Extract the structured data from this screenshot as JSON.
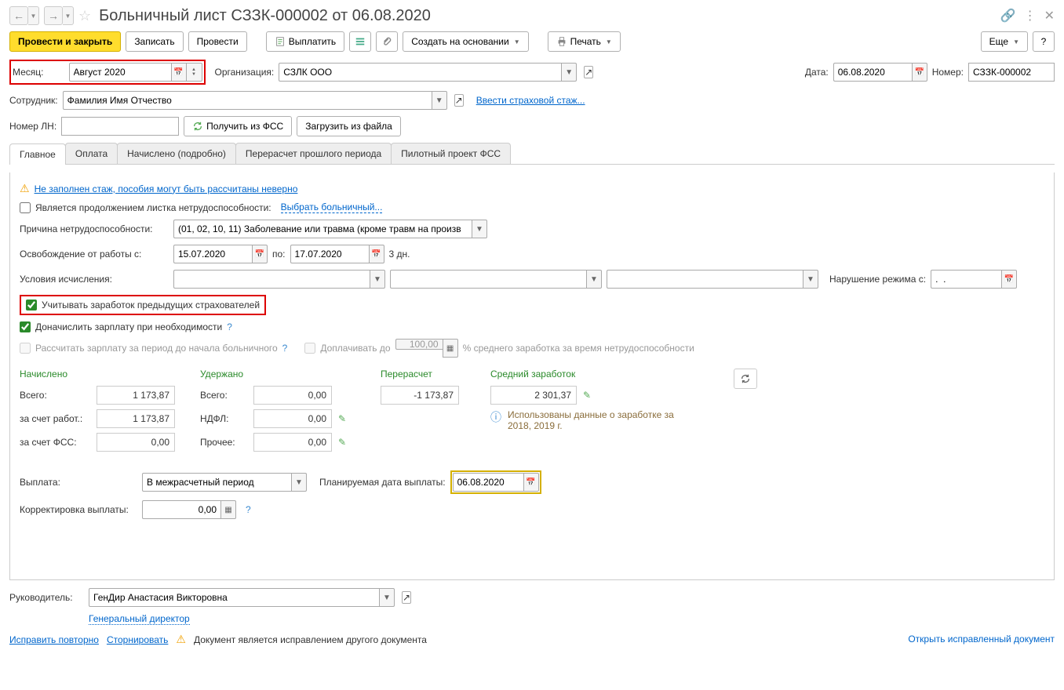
{
  "title": "Больничный лист СЗЗК-000002 от 06.08.2020",
  "toolbar": {
    "post_close": "Провести и закрыть",
    "save": "Записать",
    "post": "Провести",
    "pay": "Выплатить",
    "create_based": "Создать на основании",
    "print": "Печать",
    "more": "Еще"
  },
  "fields": {
    "month_label": "Месяц:",
    "month": "Август 2020",
    "org_label": "Организация:",
    "org": "СЗЛК ООО",
    "date_label": "Дата:",
    "date": "06.08.2020",
    "number_label": "Номер:",
    "number": "СЗЗК-000002",
    "employee_label": "Сотрудник:",
    "employee": "Фамилия Имя Отчество",
    "insurance_link": "Ввести страховой стаж...",
    "ln_label": "Номер ЛН:",
    "get_fss": "Получить из ФСС",
    "load_file": "Загрузить из файла"
  },
  "tabs": [
    "Главное",
    "Оплата",
    "Начислено (подробно)",
    "Перерасчет прошлого периода",
    "Пилотный проект ФСС"
  ],
  "main": {
    "warning": "Не заполнен стаж, пособия могут быть рассчитаны неверно",
    "is_continuation": "Является продолжением листка нетрудоспособности:",
    "select_sick": "Выбрать больничный...",
    "reason_label": "Причина нетрудоспособности:",
    "reason": "(01, 02, 10, 11) Заболевание или травма (кроме травм на произв",
    "exempt_from": "Освобождение от работы с:",
    "date_from": "15.07.2020",
    "date_to_label": "по:",
    "date_to": "17.07.2020",
    "days": "3 дн.",
    "calc_cond": "Условия исчисления:",
    "violation_label": "Нарушение режима с:",
    "violation_date": ".  .",
    "cb_prev_insurers": "Учитывать заработок предыдущих страхователей",
    "cb_add_salary": "Доначислить зарплату при необходимости",
    "cb_calc_salary": "Рассчитать зарплату за период до начала больничного",
    "cb_pay_up": "Доплачивать до",
    "pay_up_val": "100,00",
    "pay_up_suffix": "% среднего заработка за время нетрудоспособности"
  },
  "summary": {
    "accrued": "Начислено",
    "withheld": "Удержано",
    "recalc": "Перерасчет",
    "avg_earn": "Средний заработок",
    "total": "Всего:",
    "employer": "за счет работ.:",
    "fss": "за счет ФСС:",
    "ndfl": "НДФЛ:",
    "other": "Прочее:",
    "accrued_total": "1 173,87",
    "accrued_employer": "1 173,87",
    "accrued_fss": "0,00",
    "withheld_total": "0,00",
    "withheld_ndfl": "0,00",
    "withheld_other": "0,00",
    "recalc_val": "-1 173,87",
    "avg_val": "2 301,37",
    "info_text": "Использованы данные о заработке за 2018, 2019 г."
  },
  "payment": {
    "label": "Выплата:",
    "value": "В межрасчетный период",
    "planned_label": "Планируемая дата выплаты:",
    "planned_date": "06.08.2020",
    "corr_label": "Корректировка выплаты:",
    "corr_val": "0,00"
  },
  "footer": {
    "head_label": "Руководитель:",
    "head": "ГенДир Анастасия Викторовна",
    "head_pos": "Генеральный директор",
    "fix_again": "Исправить повторно",
    "reverse": "Сторнировать",
    "doc_info": "Документ является исправлением другого документа",
    "open_corrected": "Открыть исправленный документ"
  }
}
